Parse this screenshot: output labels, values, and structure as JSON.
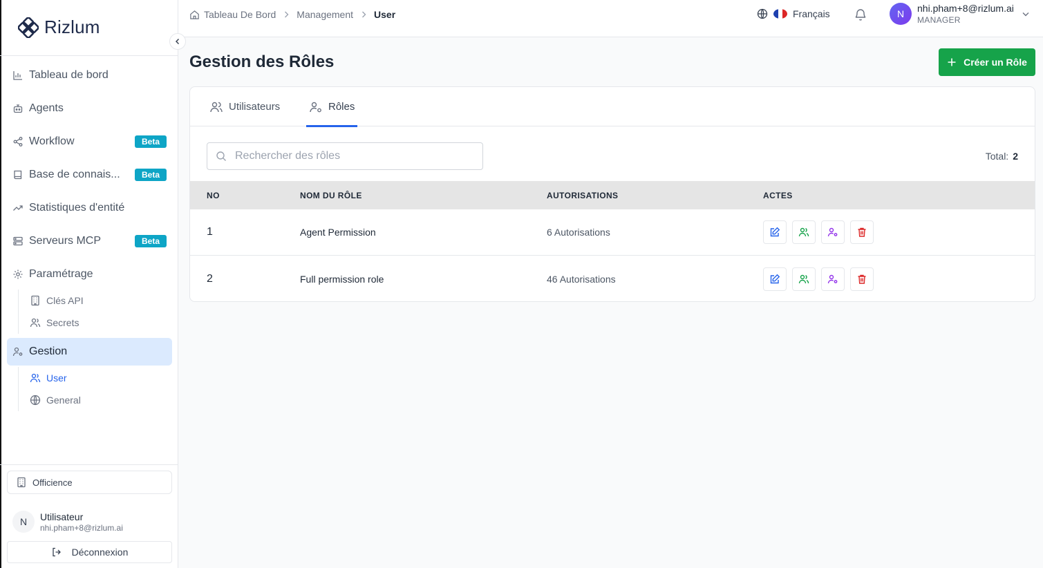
{
  "sidebar": {
    "logo_text": "Rizlum",
    "items": [
      {
        "label": "Tableau de bord",
        "icon": "bar-chart-icon"
      },
      {
        "label": "Agents",
        "icon": "bot-icon"
      },
      {
        "label": "Workflow",
        "icon": "share-icon",
        "badge": "Beta"
      },
      {
        "label": "Base de connais...",
        "icon": "book-icon",
        "badge": "Beta"
      },
      {
        "label": "Statistiques d'entité",
        "icon": "trending-up-icon"
      },
      {
        "label": "Serveurs MCP",
        "icon": "server-icon",
        "badge": "Beta"
      },
      {
        "label": "Paramétrage",
        "icon": "gear-icon"
      },
      {
        "label": "Gestion",
        "icon": "user-cog-icon"
      }
    ],
    "settings_sub": [
      {
        "label": "Clés API",
        "icon": "building-icon"
      },
      {
        "label": "Secrets",
        "icon": "users-icon"
      }
    ],
    "gestion_sub": [
      {
        "label": "User",
        "icon": "users-icon"
      },
      {
        "label": "General",
        "icon": "globe-icon"
      }
    ],
    "organization": "Officience",
    "user": {
      "avatar": "N",
      "name": "Utilisateur",
      "email": "nhi.pham+8@rizlum.ai"
    },
    "logout_label": "Déconnexion"
  },
  "header": {
    "breadcrumbs": [
      "Tableau De Bord",
      "Management",
      "User"
    ],
    "language": "Français",
    "profile": {
      "avatar": "N",
      "email": "nhi.pham+8@rizlum.ai",
      "role": "MANAGER"
    }
  },
  "main": {
    "title": "Gestion des Rôles",
    "create_button": "Créer un Rôle",
    "tabs": [
      {
        "label": "Utilisateurs",
        "icon": "users-icon"
      },
      {
        "label": "Rôles",
        "icon": "user-cog-icon"
      }
    ],
    "search_placeholder": "Rechercher des rôles",
    "total_label": "Total:",
    "total_value": "2",
    "table": {
      "columns": [
        "NO",
        "NOM DU RÔLE",
        "AUTORISATIONS",
        "ACTES"
      ],
      "rows": [
        {
          "no": "1",
          "name": "Agent Permission",
          "permissions": "6 Autorisations"
        },
        {
          "no": "2",
          "name": "Full permission role",
          "permissions": "46 Autorisations"
        }
      ]
    }
  },
  "colors": {
    "accent": "#2563eb",
    "primary_button": "#16a34a",
    "badge": "#0ea5c6",
    "active_nav": "#dbeafe",
    "edit_icon": "#2563eb",
    "members_icon": "#16a34a",
    "assign_icon": "#9333ea",
    "delete_icon": "#dc2626"
  }
}
